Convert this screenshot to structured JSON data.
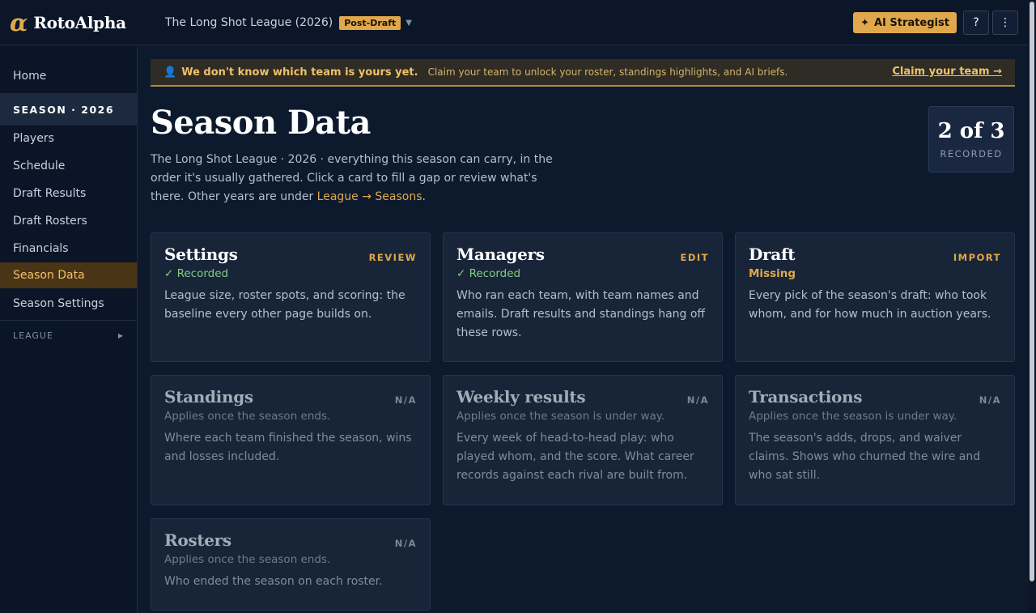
{
  "app": {
    "logo_mark": "α",
    "name": "RotoAlpha",
    "league_name": "The Long Shot League (2026)",
    "league_badge": "Post-Draft",
    "ai_button": "AI Strategist",
    "help_button": "?",
    "more_button": "⋮"
  },
  "sidebar": {
    "home": "Home",
    "section": "SEASON · 2026",
    "items": [
      "Players",
      "Schedule",
      "Draft Results",
      "Draft Rosters",
      "Financials",
      "Season Data",
      "Season Settings"
    ],
    "active": "Season Data",
    "league": "LEAGUE"
  },
  "banner": {
    "strong": "We don't know which team is yours yet.",
    "sub": "Claim your team to unlock your roster, standings highlights, and AI briefs.",
    "link": "Claim your team →"
  },
  "header": {
    "title": "Season Data",
    "desc": "The Long Shot League · 2026 · everything this season can carry, in the order it's usually gathered. Click a card to fill a gap or review what's there. Other years are under ",
    "link": "League → Seasons",
    "desc_end": "."
  },
  "counter": {
    "value": "2 of 3",
    "label": "RECORDED"
  },
  "cards": [
    {
      "title": "Settings",
      "action": "REVIEW",
      "status": "✓ Recorded",
      "desc": "League size, roster spots, and scoring: the baseline every other page builds on."
    },
    {
      "title": "Managers",
      "action": "EDIT",
      "status": "✓ Recorded",
      "desc": "Who ran each team, with team names and emails. Draft results and standings hang off these rows."
    },
    {
      "title": "Draft",
      "action": "IMPORT",
      "status": "Missing",
      "desc": "Every pick of the season's draft: who took whom, and for how much in auction years."
    },
    {
      "title": "Standings",
      "action": "N/A",
      "status": "Applies once the season ends.",
      "desc": "Where each team finished the season, wins and losses included."
    },
    {
      "title": "Weekly results",
      "action": "N/A",
      "status": "Applies once the season is under way.",
      "desc": "Every week of head-to-head play: who played whom, and the score. What career records against each rival are built from."
    },
    {
      "title": "Transactions",
      "action": "N/A",
      "status": "Applies once the season is under way.",
      "desc": "The season's adds, drops, and waiver claims. Shows who churned the wire and who sat still."
    },
    {
      "title": "Rosters",
      "action": "N/A",
      "status": "Applies once the season ends.",
      "desc": "Who ended the season on each roster."
    }
  ]
}
